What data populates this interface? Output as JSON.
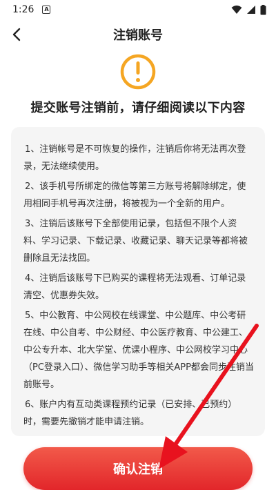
{
  "status_bar": {
    "time": "1:26",
    "notification_icon": "a-icon",
    "icons": [
      "wifi-icon",
      "signal-icon",
      "battery-icon"
    ]
  },
  "nav": {
    "title": "注销账号",
    "back_icon": "chevron-left-icon"
  },
  "warning": {
    "icon": "exclamation-circle-icon",
    "color": "#f5a623"
  },
  "heading": "提交账号注销前，请仔细阅读以下内容",
  "notice_items": [
    "1、注销帐号是不可恢复的操作，注销后你将无法再次登录，无法继续使用。",
    "2、该手机号所绑定的微信等第三方账号将解除绑定，使用相同手机号再次注册，将被视为一个全新的用户。",
    "3、注销后该账号下全部使用记录，包括但不限个人资料、学习记录、下载记录、收藏记录、聊天记录等都将被删除且无法找回。",
    "4、注销后该账号下已购买的课程将无法观看、订单记录清空、优惠券失效。",
    "5、中公教育、中公网校在线课堂、中公题库、中公考研在线、中公自考、中公财经、中公医疗教育、中公建工、中公专升本、北大学堂、优课小程序、中公网校学习中心（PC登录入口）、微信学习助手等相关APP都会同步注销当前账号。",
    "6、账户内有互动类课程预约记录（已安排、已预约）时，需要先撤销才能申请注销。"
  ],
  "confirm_button": {
    "label": "确认注销",
    "color": "#e2262a"
  },
  "annotation": {
    "type": "red-arrow",
    "color": "#e8121e"
  }
}
